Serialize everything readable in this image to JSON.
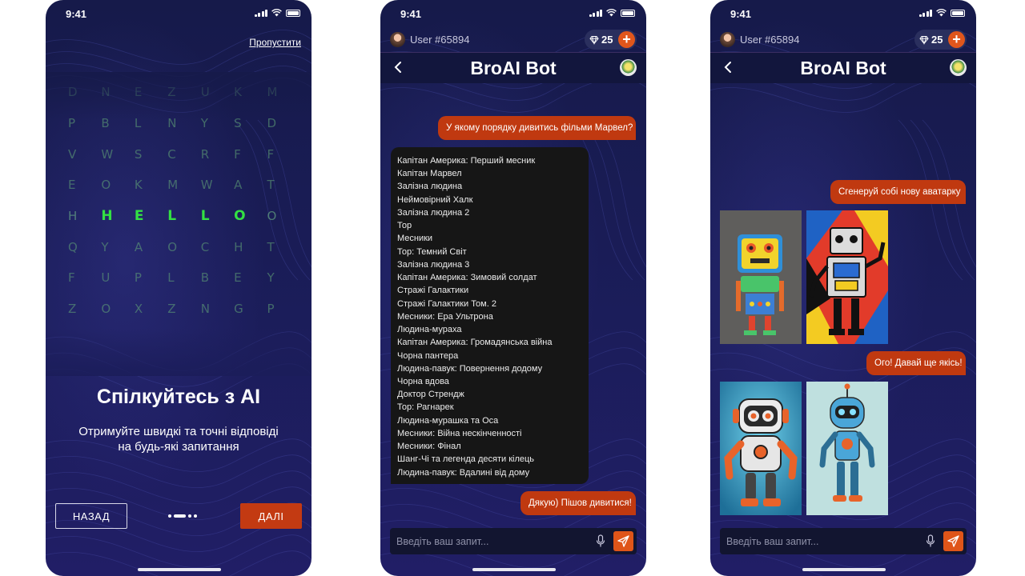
{
  "status": {
    "time": "9:41"
  },
  "onboarding": {
    "skip_label": "Пропустити",
    "grid": [
      [
        "D",
        "N",
        "E",
        "Z",
        "U",
        "K",
        "M"
      ],
      [
        "P",
        "B",
        "L",
        "N",
        "Y",
        "S",
        "D"
      ],
      [
        "V",
        "W",
        "S",
        "C",
        "R",
        "F",
        "F"
      ],
      [
        "E",
        "O",
        "K",
        "M",
        "W",
        "A",
        "T"
      ],
      [
        "H",
        "H",
        "E",
        "L",
        "L",
        "O",
        "O"
      ],
      [
        "Q",
        "Y",
        "A",
        "O",
        "C",
        "H",
        "T"
      ],
      [
        "F",
        "U",
        "P",
        "L",
        "B",
        "E",
        "Y"
      ],
      [
        "Z",
        "O",
        "X",
        "Z",
        "N",
        "G",
        "P"
      ]
    ],
    "highlight_word": "HELLO",
    "title": "Спілкуйтесь з AI",
    "subtitle": "Отримуйте швидкі та точні відповіді\nна будь-які запитання",
    "back_label": "НАЗАД",
    "next_label": "ДАЛІ",
    "active_page": 1,
    "page_count": 4
  },
  "chat": {
    "user_name": "User #65894",
    "gems": "25",
    "bot_name": "BroAI Bot",
    "input_placeholder": "Введіть ваш запит...",
    "question": "У якому порядку дивитись фільми Марвел?",
    "answer_lines": [
      "Капітан Америка: Перший месник",
      "Капітан Марвел",
      "Залізна людина",
      "Неймовірний Халк",
      "Залізна людина 2",
      "Тор",
      "Месники",
      "Тор: Темний Світ",
      "Залізна людина 3",
      "Капітан Америка: Зимовий солдат",
      "Стражі Галактики",
      "Стражі Галактики Том. 2",
      "Месники: Ера Ультрона",
      "Людина-мураха",
      "Капітан Америка: Громадянська війна",
      "Чорна пантера",
      "Людина-павук: Повернення додому",
      "Чорна вдова",
      "Доктор Стрендж",
      "Тор: Рагнарек",
      "Людина-мурашка та Оса",
      "Месники: Війна нескінченності",
      "Месники: Фінал",
      "Шанг-Чі та легенда десяти кілець",
      "Людина-павук: Вдалині від дому"
    ],
    "thanks": "Дякую) Пішов дивитися!",
    "avatar_request": "Сгенеруй собі нову аватарку",
    "more_request": "Ого! Давай ще якісь!"
  },
  "colors": {
    "accent": "#c33a12",
    "highlight": "#33e043",
    "background": "#1b1d5a"
  }
}
